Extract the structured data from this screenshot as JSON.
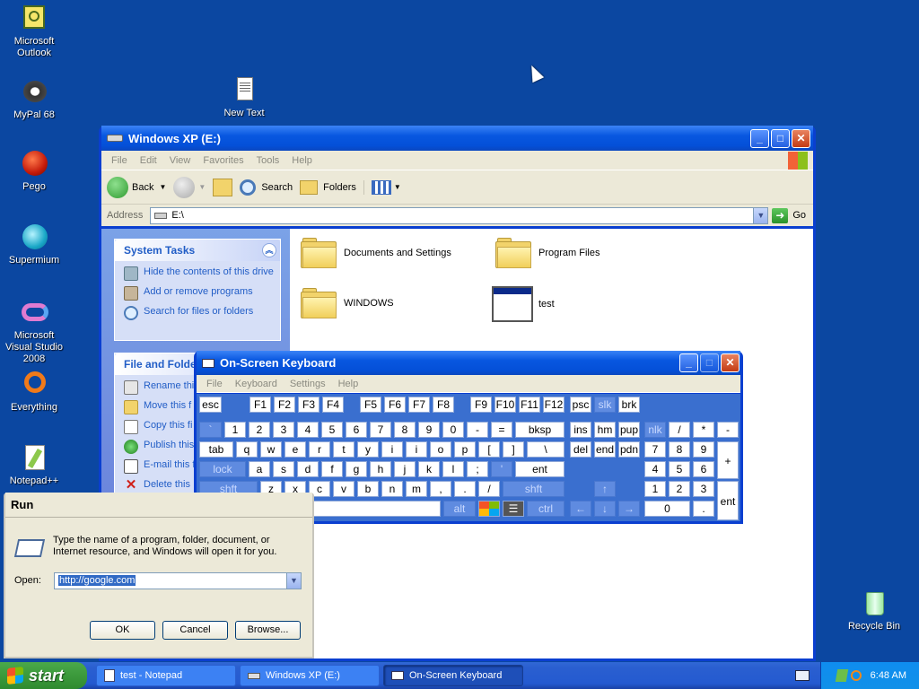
{
  "desktop": {
    "icons": [
      {
        "label": "Microsoft Outlook",
        "icon": "outlook-icon"
      },
      {
        "label": "MyPal 68",
        "icon": "mypal-icon"
      },
      {
        "label": "Pego",
        "icon": "pego-icon"
      },
      {
        "label": "Supermium",
        "icon": "supermium-icon"
      },
      {
        "label": "Microsoft Visual Studio 2008",
        "icon": "visual-studio-icon"
      },
      {
        "label": "Everything",
        "icon": "everything-icon"
      },
      {
        "label": "Notepad++",
        "icon": "notepadpp-icon"
      },
      {
        "label": "New Text",
        "icon": "text-document-icon"
      },
      {
        "label": "Recycle Bin",
        "icon": "recycle-bin-icon"
      }
    ]
  },
  "explorer": {
    "title": "Windows XP (E:)",
    "menu": [
      "File",
      "Edit",
      "View",
      "Favorites",
      "Tools",
      "Help"
    ],
    "toolbar": {
      "back": "Back",
      "search": "Search",
      "folders": "Folders"
    },
    "address_label": "Address",
    "address_value": "E:\\",
    "go_label": "Go",
    "system_tasks": {
      "title": "System Tasks",
      "items": [
        "Hide the contents of this drive",
        "Add or remove programs",
        "Search for files or folders"
      ]
    },
    "file_tasks": {
      "title": "File and Folde",
      "items": [
        "Rename thi",
        "Move this f",
        "Copy this fi",
        "Publish this",
        "E-mail this fi",
        "Delete this"
      ]
    },
    "items": [
      {
        "name": "Documents and Settings",
        "type": "folder"
      },
      {
        "name": "Program Files",
        "type": "folder"
      },
      {
        "name": "WINDOWS",
        "type": "folder"
      },
      {
        "name": "test",
        "type": "file"
      }
    ]
  },
  "osk": {
    "title": "On-Screen Keyboard",
    "menu": [
      "File",
      "Keyboard",
      "Settings",
      "Help"
    ]
  },
  "run": {
    "title": "Run",
    "description": "Type the name of a program, folder, document, or Internet resource, and Windows will open it for you.",
    "open_label": "Open:",
    "open_value": "http://google.com",
    "ok": "OK",
    "cancel": "Cancel",
    "browse": "Browse..."
  },
  "taskbar": {
    "start": "start",
    "buttons": [
      "test - Notepad",
      "Windows XP (E:)",
      "On-Screen Keyboard"
    ],
    "clock": "6:48 AM"
  },
  "colors": {
    "desktop": "#0b47a1",
    "titlebar": "#0857e0",
    "start": "#3c9a3c"
  }
}
